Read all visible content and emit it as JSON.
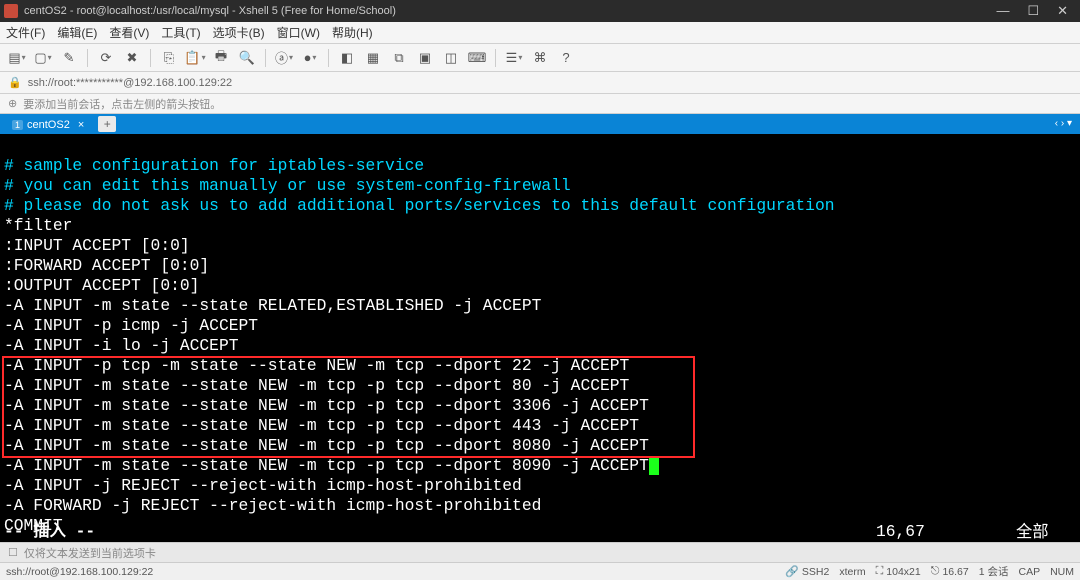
{
  "titlebar": {
    "title": "centOS2 - root@localhost:/usr/local/mysql - Xshell 5 (Free for Home/School)",
    "min": "—",
    "max": "☐",
    "close": "✕"
  },
  "menubar": {
    "file": "文件(F)",
    "edit": "编辑(E)",
    "view": "查看(V)",
    "tools": "工具(T)",
    "tabs": "选项卡(B)",
    "window": "窗口(W)",
    "help": "帮助(H)"
  },
  "addressbar": {
    "text": "ssh://root:***********@192.168.100.129:22"
  },
  "hintbar": {
    "text": "要添加当前会话，点击左侧的箭头按钮。"
  },
  "tabs": {
    "active": {
      "num": "1",
      "label": "centOS2",
      "x": "×"
    },
    "add": "+",
    "dots": "‹ › ▾"
  },
  "terminal": {
    "comment1": "# sample configuration for iptables-service",
    "comment2": "# you can edit this manually or use system-config-firewall",
    "comment3": "# please do not ask us to add additional ports/services to this default configuration",
    "l4": "*filter",
    "l5": ":INPUT ACCEPT [0:0]",
    "l6": ":FORWARD ACCEPT [0:0]",
    "l7": ":OUTPUT ACCEPT [0:0]",
    "l8": "-A INPUT -m state --state RELATED,ESTABLISHED -j ACCEPT",
    "l9": "-A INPUT -p icmp -j ACCEPT",
    "l10": "-A INPUT -i lo -j ACCEPT",
    "l11": "-A INPUT -p tcp -m state --state NEW -m tcp --dport 22 -j ACCEPT",
    "l12": "-A INPUT -m state --state NEW -m tcp -p tcp --dport 80 -j ACCEPT",
    "l13": "-A INPUT -m state --state NEW -m tcp -p tcp --dport 3306 -j ACCEPT",
    "l14": "-A INPUT -m state --state NEW -m tcp -p tcp --dport 443 -j ACCEPT",
    "l15": "-A INPUT -m state --state NEW -m tcp -p tcp --dport 8080 -j ACCEPT",
    "l16": "-A INPUT -m state --state NEW -m tcp -p tcp --dport 8090 -j ACCEPT",
    "l17": "-A INPUT -j REJECT --reject-with icmp-host-prohibited",
    "l18": "-A FORWARD -j REJECT --reject-with icmp-host-prohibited",
    "l19": "COMMIT",
    "tilde": "~",
    "mode": "-- 插入 --",
    "pos": "16,67",
    "all": "全部"
  },
  "infobar": {
    "text": "仅将文本发送到当前选项卡"
  },
  "statusbar": {
    "left": "ssh://root@192.168.100.129:22",
    "ssh": "SSH2",
    "term": "xterm",
    "size": "104x21",
    "enc": "16.67",
    "sess": "1 会话",
    "cap": "CAP",
    "num": "NUM"
  },
  "icons": {
    "new": "▤",
    "open": "▢",
    "brush": "✎",
    "sep": "|",
    "reconnect": "⟳",
    "disconnect": "✖",
    "copy": "⎘",
    "paste": "📋",
    "print": "🖶",
    "find": "🔍",
    "a": "ⓐ",
    "b": "●",
    "c": "◧",
    "d": "▦",
    "e": "⧉",
    "f": "▣",
    "g": "◫",
    "h": "⌨",
    "i": "☰",
    "j": "⌘",
    "k": "?"
  }
}
